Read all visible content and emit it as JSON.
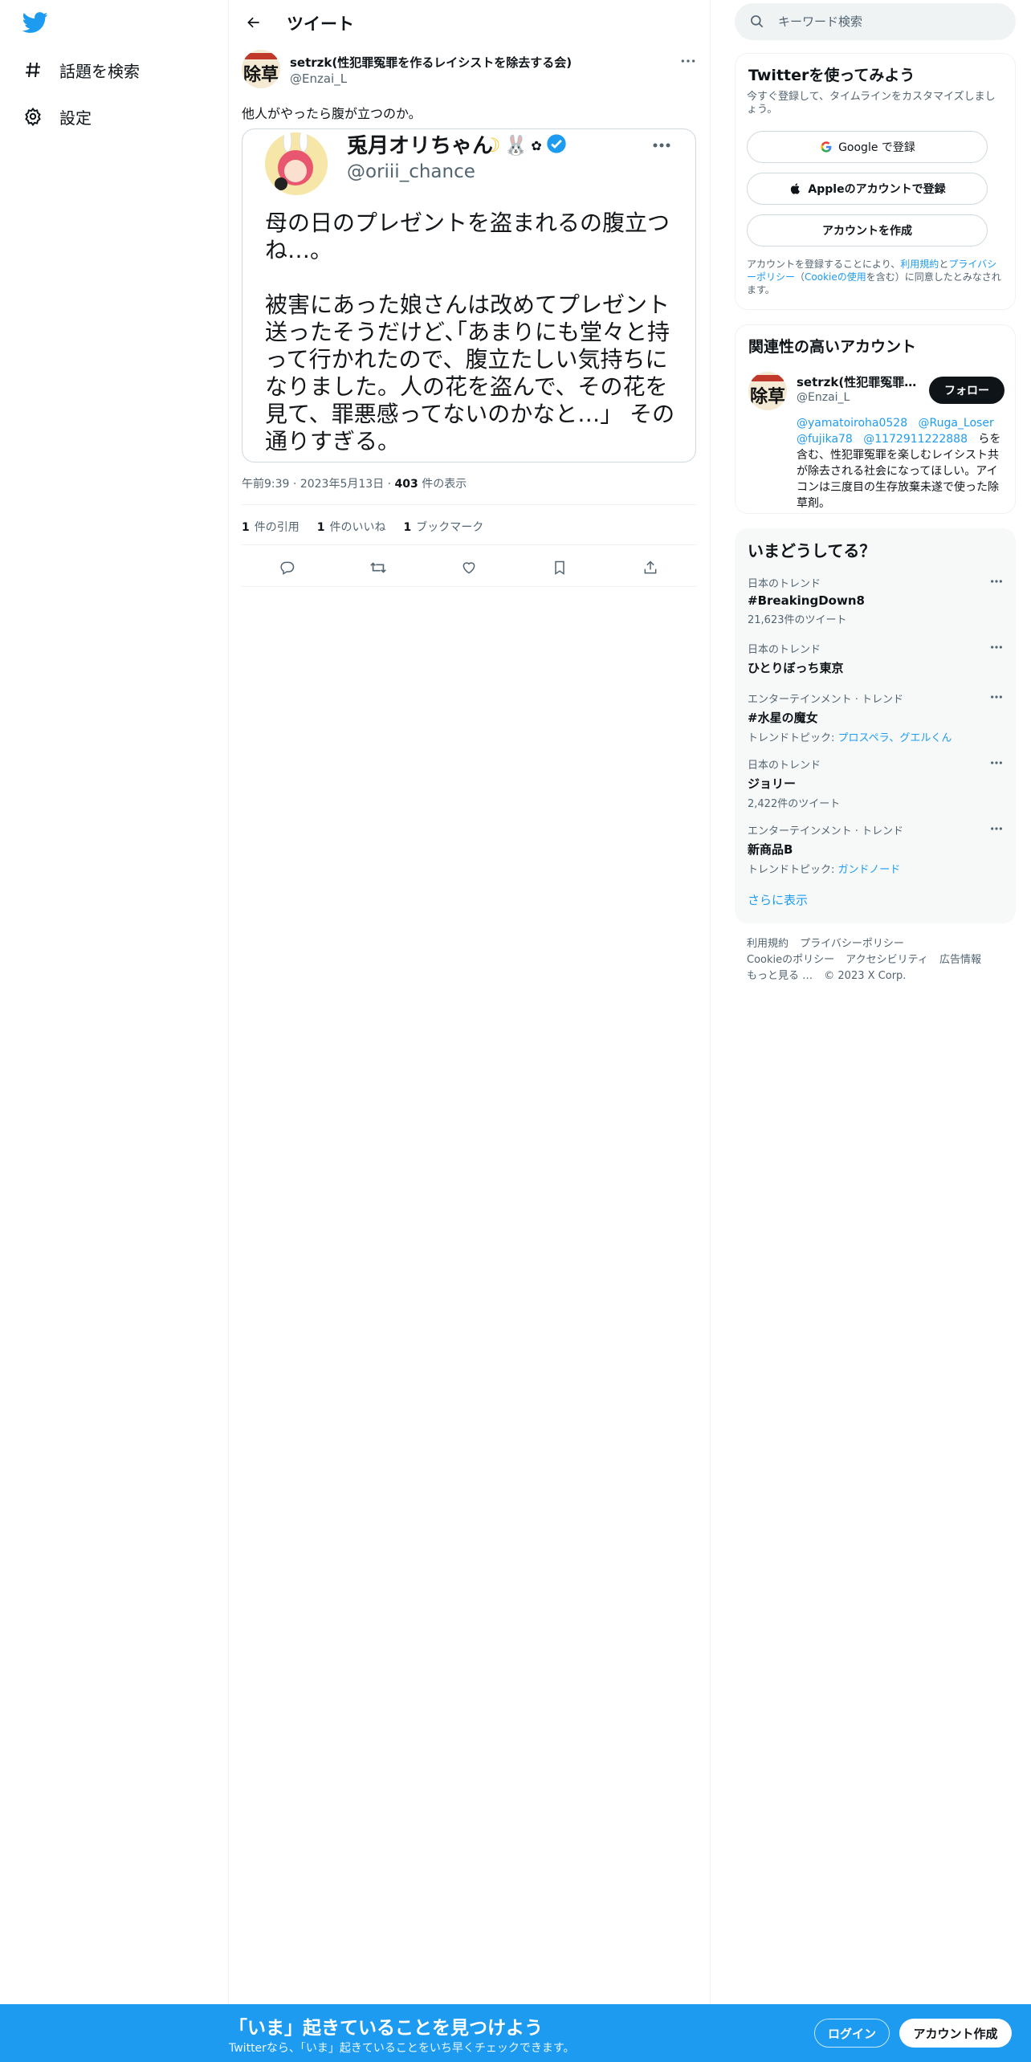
{
  "app": {
    "logo": "twitter-bird-icon",
    "accent": "#1d9bf0"
  },
  "nav": {
    "items": [
      {
        "label": "話題を検索",
        "icon": "hashtag-icon"
      },
      {
        "label": "設定",
        "icon": "gear-icon"
      }
    ]
  },
  "header": {
    "title": "ツイート"
  },
  "tweet": {
    "author_name": "setrzk(性犯罪冤罪を作るレイシストを除去する会)",
    "author_handle": "@Enzai_L",
    "text": "他人がやったら腹が立つのか。",
    "image": {
      "name": "兎月オリちゃん",
      "handle": "@oriii_chance",
      "body": "母の日のプレゼントを盗まれるの腹立つね…。\n\n被害にあった娘さんは改めてプレゼント送ったそうだけど､｢あまりにも堂々と持って行かれたので、腹立たしい気持ちになりました。人の花を盗んで、その花を見て、罪悪感ってないのかなと…」 その通りすぎる。"
    },
    "time": "午前9:39",
    "date": "2023年5月13日",
    "views_count": "403",
    "views_label": "件の表示",
    "stats": [
      {
        "count": "1",
        "label": "件の引用"
      },
      {
        "count": "1",
        "label": "件のいいね"
      },
      {
        "count": "1",
        "label": "ブックマーク"
      }
    ]
  },
  "search": {
    "placeholder": "キーワード検索"
  },
  "signup_card": {
    "title": "Twitterを使ってみよう",
    "subtitle": "今すぐ登録して、タイムラインをカスタマイズしましょう。",
    "google_label": "Google で登録",
    "apple_label": "Appleのアカウントで登録",
    "create_label": "アカウントを作成",
    "legal_prefix": "アカウントを登録することにより、",
    "legal_terms": "利用規約",
    "legal_and": "と",
    "legal_privacy": "プライバシーポリシー",
    "legal_paren_open": "（",
    "legal_cookie": "Cookieの使用",
    "legal_suffix": "を含む）に同意したとみなされます。"
  },
  "related": {
    "title": "関連性の高いアカウント",
    "name": "setrzk(性犯罪冤罪を作るレイシストを除去する会)",
    "handle": "@Enzai_L",
    "follow_label": "フォロー",
    "mention1": "@yamatoiroha0528",
    "mention2": "@Ruga_Loser",
    "mention3": "@fujika78",
    "mention4": "@1172911222888",
    "bio_rest": "らを含む、性犯罪冤罪を楽しむレイシスト共が除去される社会になってほしい。アイコンは三度目の生存放棄未遂で使った除草剤。"
  },
  "trends": {
    "title": "いまどうしてる？",
    "items": [
      {
        "category": "日本のトレンド",
        "name": "#BreakingDown8",
        "sub": "21,623件のツイート"
      },
      {
        "category": "日本のトレンド",
        "name": "ひとりぼっち東京",
        "sub": ""
      },
      {
        "category": "エンターテインメント · トレンド",
        "name": "#水星の魔女",
        "sub_prefix": "トレンドトピック: ",
        "sub_link": "プロスペラ、グエルくん"
      },
      {
        "category": "日本のトレンド",
        "name": "ジョリー",
        "sub": "2,422件のツイート"
      },
      {
        "category": "エンターテインメント · トレンド",
        "name": "新商品B",
        "sub_prefix": "トレンドトピック: ",
        "sub_link": "ガンドノード"
      }
    ],
    "show_more": "さらに表示"
  },
  "footer": {
    "links": [
      "利用規約",
      "プライバシーポリシー",
      "Cookieのポリシー",
      "アクセシビリティ",
      "広告情報",
      "もっと見る …",
      "© 2023 X Corp."
    ]
  },
  "bottom_bar": {
    "title": "「いま」起きていることを見つけよう",
    "subtitle": "Twitterなら、「いま」起きていることをいち早くチェックできます。",
    "login_label": "ログイン",
    "signup_label": "アカウント作成"
  }
}
